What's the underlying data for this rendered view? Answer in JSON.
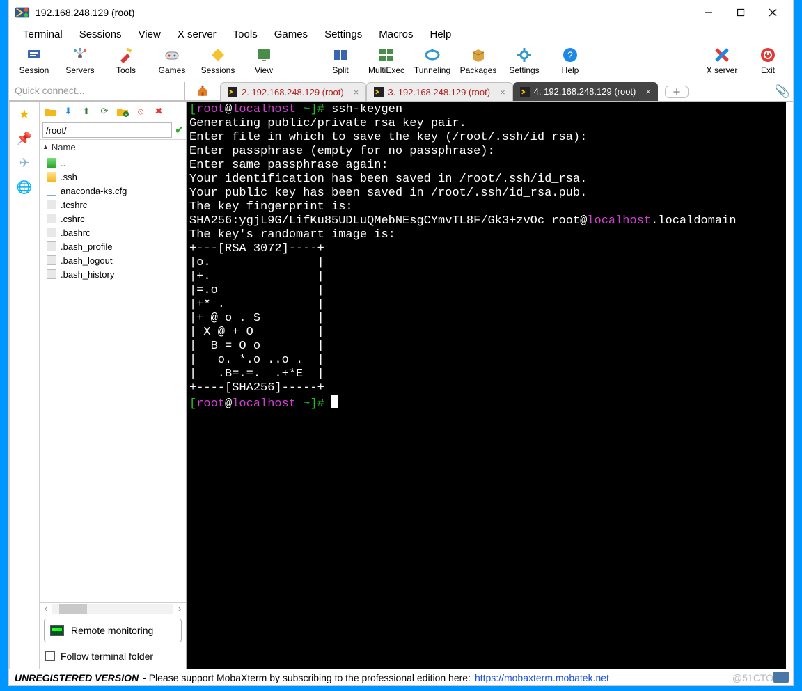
{
  "title": "192.168.248.129 (root)",
  "menu": [
    "Terminal",
    "Sessions",
    "View",
    "X server",
    "Tools",
    "Games",
    "Settings",
    "Macros",
    "Help"
  ],
  "toolbar": [
    {
      "id": "session",
      "label": "Session"
    },
    {
      "id": "servers",
      "label": "Servers"
    },
    {
      "id": "tools",
      "label": "Tools"
    },
    {
      "id": "games",
      "label": "Games"
    },
    {
      "id": "sessions",
      "label": "Sessions"
    },
    {
      "id": "view",
      "label": "View"
    },
    {
      "id": "split",
      "label": "Split"
    },
    {
      "id": "multiexec",
      "label": "MultiExec"
    },
    {
      "id": "tunneling",
      "label": "Tunneling"
    },
    {
      "id": "packages",
      "label": "Packages"
    },
    {
      "id": "settings",
      "label": "Settings"
    },
    {
      "id": "help",
      "label": "Help"
    }
  ],
  "toolbar_right": [
    {
      "id": "xserver",
      "label": "X server"
    },
    {
      "id": "exit",
      "label": "Exit"
    }
  ],
  "quick_connect_placeholder": "Quick connect...",
  "tabs": [
    {
      "label": "2. 192.168.248.129 (root)",
      "active": false
    },
    {
      "label": "3. 192.168.248.129 (root)",
      "active": false
    },
    {
      "label": "4. 192.168.248.129 (root)",
      "active": true
    }
  ],
  "filepanel": {
    "path": "/root/",
    "header": "Name",
    "items": [
      {
        "name": "..",
        "type": "folder-green"
      },
      {
        "name": ".ssh",
        "type": "folder"
      },
      {
        "name": "anaconda-ks.cfg",
        "type": "page"
      },
      {
        "name": ".tcshrc",
        "type": "doc"
      },
      {
        "name": ".cshrc",
        "type": "doc"
      },
      {
        "name": ".bashrc",
        "type": "doc"
      },
      {
        "name": ".bash_profile",
        "type": "doc"
      },
      {
        "name": ".bash_logout",
        "type": "doc"
      },
      {
        "name": ".bash_history",
        "type": "doc"
      }
    ],
    "remote_monitoring": "Remote monitoring",
    "follow": "Follow terminal folder"
  },
  "terminal": {
    "prompt_user": "root",
    "prompt_at": "@",
    "prompt_host": "localhost",
    "prompt_tail": " ~]# ",
    "cmd": "ssh-keygen",
    "l1": "Generating public/private rsa key pair.",
    "l2": "Enter file in which to save the key (/root/.ssh/id_rsa):",
    "l3": "Enter passphrase (empty for no passphrase):",
    "l4": "Enter same passphrase again:",
    "l5": "Your identification has been saved in /root/.ssh/id_rsa.",
    "l6": "Your public key has been saved in /root/.ssh/id_rsa.pub.",
    "l7": "The key fingerprint is:",
    "l8a": "SHA256:ygjL9G/LifKu85UDLuQMebNEsgCYmvTL8F/Gk3+zvOc root@",
    "l8b": "localhost",
    "l8c": ".localdomain",
    "l9": "The key's randomart image is:",
    "a0": "+---[RSA 3072]----+",
    "a1": "|o.               |",
    "a2": "|+.               |",
    "a3": "|=.o              |",
    "a4": "|+* .             |",
    "a5": "|+ @ o . S        |",
    "a6": "| X @ + O         |",
    "a7": "|  B = O o        |",
    "a8": "|   o. *.o ..o .  |",
    "a9": "|   .B=.=.  .+*E  |",
    "a10": "+----[SHA256]-----+"
  },
  "status": {
    "unreg": "UNREGISTERED VERSION",
    "msg": " -  Please support MobaXterm by subscribing to the professional edition here: ",
    "link": "https://mobaxterm.mobatek.net"
  },
  "watermark": "@51CTO"
}
